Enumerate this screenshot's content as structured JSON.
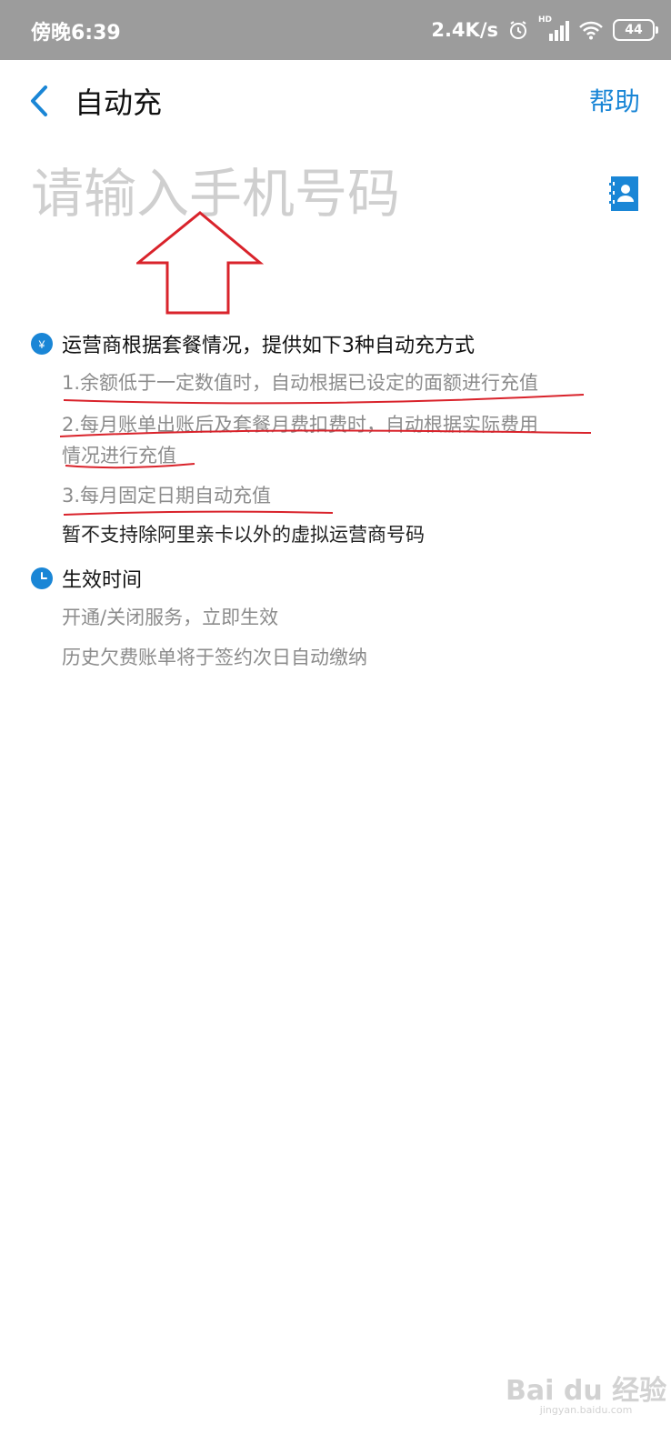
{
  "status_bar": {
    "time": "傍晚6:39",
    "speed": "2.4K/s",
    "network_label": "HD",
    "battery": "44"
  },
  "nav": {
    "title": "自动充",
    "help": "帮助"
  },
  "phone": {
    "placeholder": "请输入手机号码"
  },
  "section_methods": {
    "title": "运营商根据套餐情况，提供如下3种自动充方式",
    "items": [
      "1.余额低于一定数值时，自动根据已设定的面额进行充值",
      "2.每月账单出账后及套餐月费扣费时，自动根据实际费用",
      "情况进行充值",
      "3.每月固定日期自动充值"
    ],
    "note": "暂不支持除阿里亲卡以外的虚拟运营商号码"
  },
  "section_effective": {
    "title": "生效时间",
    "items": [
      "开通/关闭服务，立即生效",
      "历史欠费账单将于签约次日自动缴纳"
    ]
  },
  "watermark": {
    "text": "Bai du 经验",
    "sub": "jingyan.baidu.com"
  },
  "colors": {
    "accent": "#1a86d6",
    "annotation": "#d9232b"
  },
  "icons": [
    "back-chevron-icon",
    "contacts-icon",
    "yuan-icon",
    "clock-icon"
  ]
}
